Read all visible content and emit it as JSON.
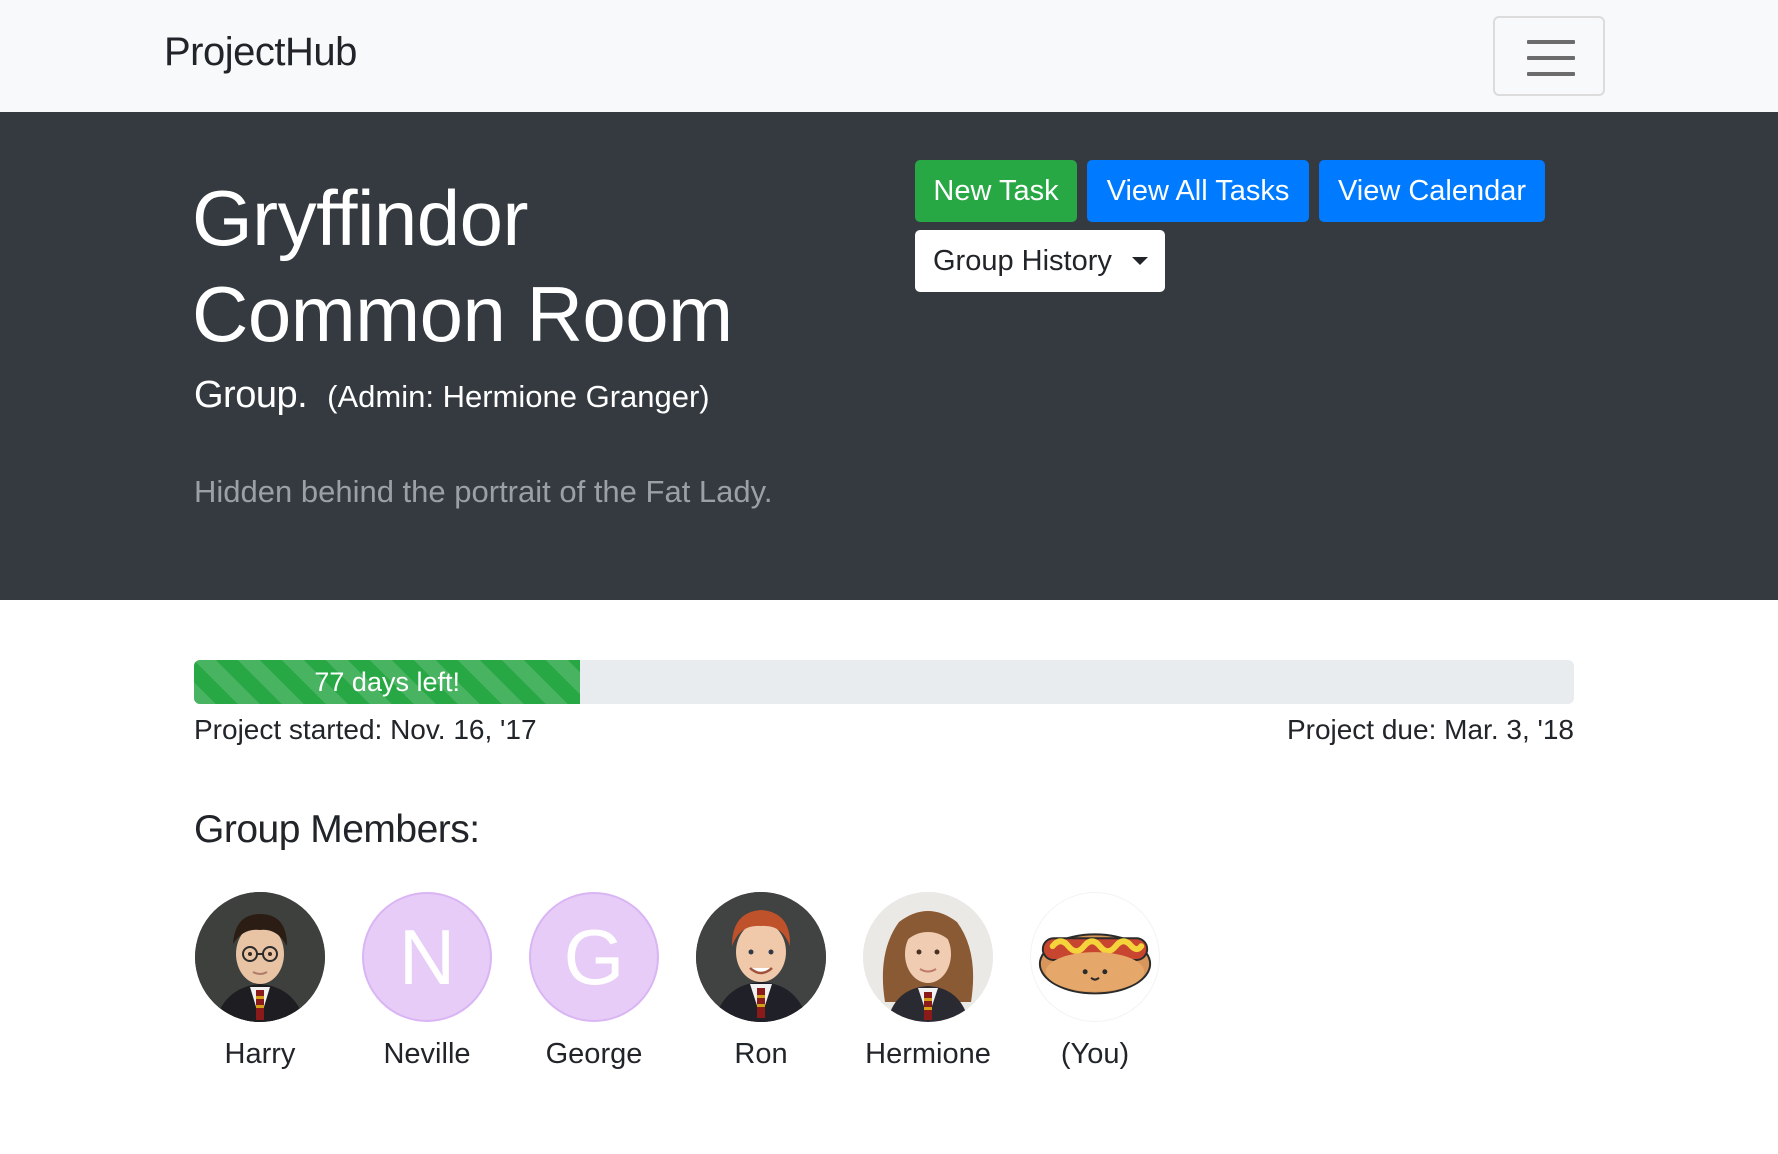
{
  "navbar": {
    "brand": "ProjectHub"
  },
  "header": {
    "title": "Gryffindor Common Room",
    "group_word": "Group.",
    "admin_text": "(Admin: Hermione Granger)",
    "description": "Hidden behind the portrait of the Fat Lady.",
    "buttons": {
      "new_task": "New Task",
      "view_all_tasks": "View All Tasks",
      "view_calendar": "View Calendar",
      "group_history": "Group History"
    }
  },
  "progress": {
    "label": "77 days left!",
    "fraction": 0.28,
    "started": "Project started: Nov. 16, '17",
    "due": "Project due: Mar. 3, '18"
  },
  "members": {
    "heading": "Group Members:",
    "list": [
      {
        "name": "Harry",
        "type": "photo",
        "icon": "harry-photo"
      },
      {
        "name": "Neville",
        "type": "letter",
        "letter": "N"
      },
      {
        "name": "George",
        "type": "letter",
        "letter": "G"
      },
      {
        "name": "Ron",
        "type": "photo",
        "icon": "ron-photo"
      },
      {
        "name": "Hermione",
        "type": "photo",
        "icon": "hermione-photo"
      },
      {
        "name": "(You)",
        "type": "icon",
        "icon": "hotdog-icon"
      }
    ]
  },
  "colors": {
    "dark_header": "#343a40",
    "success": "#28a745",
    "primary": "#007bff",
    "avatar_letter_bg": "#e6ccf7"
  }
}
